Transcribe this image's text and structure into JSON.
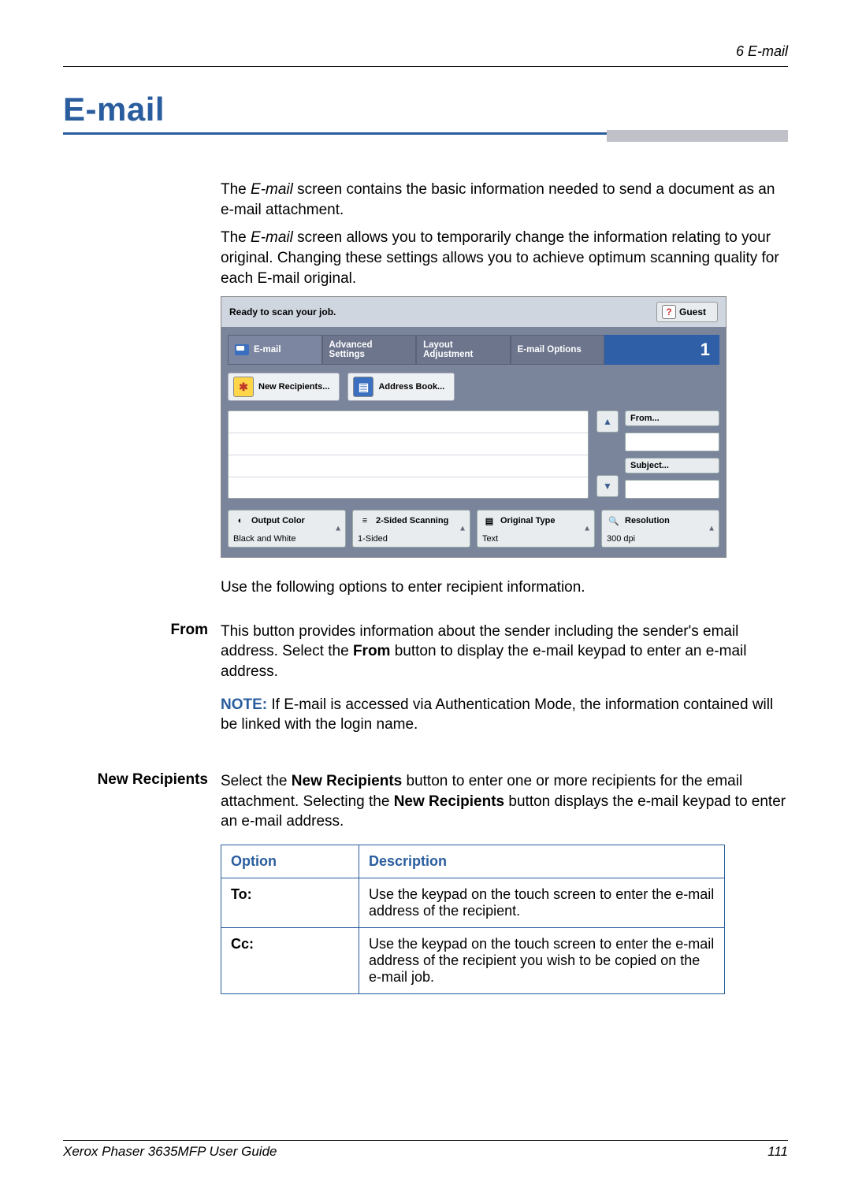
{
  "header": {
    "breadcrumb": "6   E-mail"
  },
  "title": "E-mail",
  "intro": {
    "p1a": "The ",
    "p1em": "E-mail",
    "p1b": " screen contains the basic information needed to send a document as an e-mail attachment.",
    "p2a": "The ",
    "p2em": "E-mail",
    "p2b": " screen allows you to temporarily change the information relating to your original. Changing these settings allows you to achieve optimum scanning quality for each E-mail original."
  },
  "screenshot": {
    "status": "Ready to scan your job.",
    "guest": "Guest",
    "tabs": {
      "email": "E-mail",
      "advanced": "Advanced Settings",
      "layout": "Layout Adjustment",
      "options": "E-mail Options",
      "one": "1"
    },
    "buttons": {
      "newRecipients": "New Recipients...",
      "addressBook": "Address Book..."
    },
    "fields": {
      "from": "From...",
      "subject": "Subject..."
    },
    "opts": {
      "outputColor": {
        "title": "Output Color",
        "value": "Black and White"
      },
      "twoSided": {
        "title": "2-Sided Scanning",
        "value": "1-Sided"
      },
      "originalType": {
        "title": "Original Type",
        "value": "Text"
      },
      "resolution": {
        "title": "Resolution",
        "value": "300 dpi"
      }
    }
  },
  "afterScreenshot": "Use the following options to enter recipient information.",
  "from": {
    "label": "From",
    "p1a": "This button provides information about the sender including the sender's email address. Select the ",
    "p1b": "From",
    "p1c": " button to display the e-mail keypad to enter an e-mail address.",
    "noteLabel": "NOTE:",
    "noteText": " If E-mail is accessed via Authentication Mode, the information contained will be linked with the login name."
  },
  "newRecipients": {
    "label": "New Recipients",
    "p1a": "Select the ",
    "p1b": "New Recipients",
    "p1c": " button to enter one or more recipients for the email attachment.  Selecting the ",
    "p1d": "New Recipients",
    "p1e": " button displays the e-mail keypad to enter an e-mail address."
  },
  "table": {
    "headers": {
      "option": "Option",
      "description": "Description"
    },
    "rows": [
      {
        "option": "To:",
        "description": "Use the keypad on the touch screen to enter the e-mail address of the recipient."
      },
      {
        "option": "Cc:",
        "description": "Use the keypad on the touch screen to enter the e-mail address of the recipient you wish to be copied on the e-mail job."
      }
    ]
  },
  "footer": {
    "left": "Xerox Phaser 3635MFP User Guide",
    "right": "111"
  }
}
